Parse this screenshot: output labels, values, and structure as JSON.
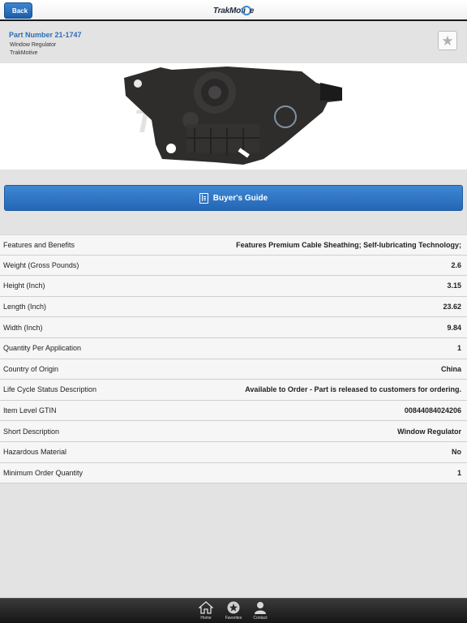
{
  "header": {
    "back_label": "Back",
    "logo_text": "TrakMotive"
  },
  "part": {
    "number": "Part Number 21-1747",
    "name": "Window Regulator",
    "brand": "TrakMotive",
    "favorite_icon": "star-icon"
  },
  "buyers_guide": {
    "label": "Buyer's Guide",
    "icon": "book-icon"
  },
  "specs": [
    {
      "label": "Features and Benefits",
      "value": "Features Premium Cable Sheathing; Self-lubricating Technology;"
    },
    {
      "label": "Weight (Gross Pounds)",
      "value": "2.6"
    },
    {
      "label": "Height (Inch)",
      "value": "3.15"
    },
    {
      "label": "Length (Inch)",
      "value": "23.62"
    },
    {
      "label": "Width (Inch)",
      "value": "9.84"
    },
    {
      "label": "Quantity Per Application",
      "value": "1"
    },
    {
      "label": "Country of Origin",
      "value": "China"
    },
    {
      "label": "Life Cycle Status Description",
      "value": "Available to Order - Part is released to customers for ordering."
    },
    {
      "label": "Item Level GTIN",
      "value": "00844084024206"
    },
    {
      "label": "Short Description",
      "value": "Window Regulator"
    },
    {
      "label": "Hazardous Material",
      "value": "No"
    },
    {
      "label": "Minimum Order Quantity",
      "value": "1"
    }
  ],
  "tabs": [
    {
      "label": "Home",
      "icon": "home-icon"
    },
    {
      "label": "Favorites",
      "icon": "star-icon"
    },
    {
      "label": "Contact",
      "icon": "person-icon"
    }
  ],
  "colors": {
    "accent": "#2e6db4",
    "button": "#2a6cb8",
    "tabbar": "#222222"
  }
}
